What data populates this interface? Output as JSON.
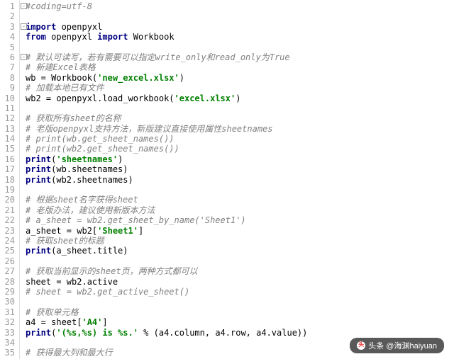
{
  "watermark": "头条 @海渊haiyuan",
  "lines": [
    {
      "n": 1,
      "fold": true,
      "tokens": [
        {
          "c": "cm",
          "t": "#coding=utf-8"
        }
      ]
    },
    {
      "n": 2,
      "tokens": []
    },
    {
      "n": 3,
      "fold": true,
      "tokens": [
        {
          "c": "kw",
          "t": "import"
        },
        {
          "c": "id",
          "t": " openpyxl"
        }
      ]
    },
    {
      "n": 4,
      "tokens": [
        {
          "c": "kw",
          "t": "from"
        },
        {
          "c": "id",
          "t": " openpyxl "
        },
        {
          "c": "kw",
          "t": "import"
        },
        {
          "c": "id",
          "t": " Workbook"
        }
      ]
    },
    {
      "n": 5,
      "tokens": []
    },
    {
      "n": 6,
      "fold": true,
      "tokens": [
        {
          "c": "cm",
          "t": "# 默认可读写，若有需要可以指定write_only和read_only为True"
        }
      ]
    },
    {
      "n": 7,
      "tokens": [
        {
          "c": "cm",
          "t": "# 新建Excel表格"
        }
      ]
    },
    {
      "n": 8,
      "tokens": [
        {
          "c": "id",
          "t": "wb = Workbook("
        },
        {
          "c": "str",
          "t": "'new_excel.xlsx'"
        },
        {
          "c": "id",
          "t": ")"
        }
      ]
    },
    {
      "n": 9,
      "tokens": [
        {
          "c": "cm",
          "t": "# 加载本地已有文件"
        }
      ]
    },
    {
      "n": 10,
      "tokens": [
        {
          "c": "id",
          "t": "wb2 = openpyxl.load_workbook("
        },
        {
          "c": "str",
          "t": "'excel.xlsx'"
        },
        {
          "c": "id",
          "t": ")"
        }
      ]
    },
    {
      "n": 11,
      "tokens": []
    },
    {
      "n": 12,
      "tokens": [
        {
          "c": "cm",
          "t": "# 获取所有sheet的名称"
        }
      ]
    },
    {
      "n": 13,
      "tokens": [
        {
          "c": "cm",
          "t": "# 老版openpyxl支持方法，新版建议直接使用属性sheetnames"
        }
      ]
    },
    {
      "n": 14,
      "tokens": [
        {
          "c": "cm",
          "t": "# print(wb.get_sheet_names())"
        }
      ]
    },
    {
      "n": 15,
      "tokens": [
        {
          "c": "cm",
          "t": "# print(wb2.get_sheet_names())"
        }
      ]
    },
    {
      "n": 16,
      "tokens": [
        {
          "c": "kw",
          "t": "print"
        },
        {
          "c": "id",
          "t": "("
        },
        {
          "c": "str",
          "t": "'sheetnames'"
        },
        {
          "c": "id",
          "t": ")"
        }
      ]
    },
    {
      "n": 17,
      "tokens": [
        {
          "c": "kw",
          "t": "print"
        },
        {
          "c": "id",
          "t": "(wb.sheetnames)"
        }
      ]
    },
    {
      "n": 18,
      "tokens": [
        {
          "c": "kw",
          "t": "print"
        },
        {
          "c": "id",
          "t": "(wb2.sheetnames)"
        }
      ]
    },
    {
      "n": 19,
      "tokens": []
    },
    {
      "n": 20,
      "tokens": [
        {
          "c": "cm",
          "t": "# 根据sheet名字获得sheet"
        }
      ]
    },
    {
      "n": 21,
      "tokens": [
        {
          "c": "cm",
          "t": "# 老版办法，建议使用新版本方法"
        }
      ]
    },
    {
      "n": 22,
      "tokens": [
        {
          "c": "cm",
          "t": "# a_sheet = wb2.get_sheet_by_name('Sheet1')"
        }
      ]
    },
    {
      "n": 23,
      "tokens": [
        {
          "c": "id",
          "t": "a_sheet = wb2["
        },
        {
          "c": "str",
          "t": "'Sheet1'"
        },
        {
          "c": "id",
          "t": "]"
        }
      ]
    },
    {
      "n": 24,
      "tokens": [
        {
          "c": "cm",
          "t": "# 获取sheet的标题"
        }
      ]
    },
    {
      "n": 25,
      "tokens": [
        {
          "c": "kw",
          "t": "print"
        },
        {
          "c": "id",
          "t": "(a_sheet.title)"
        }
      ]
    },
    {
      "n": 26,
      "tokens": []
    },
    {
      "n": 27,
      "tokens": [
        {
          "c": "cm",
          "t": "# 获取当前显示的sheet页，两种方式都可以"
        }
      ]
    },
    {
      "n": 28,
      "tokens": [
        {
          "c": "id",
          "t": "sheet = wb2.active"
        }
      ]
    },
    {
      "n": 29,
      "tokens": [
        {
          "c": "cm",
          "t": "# sheet = wb2.get_active_sheet()"
        }
      ]
    },
    {
      "n": 30,
      "tokens": []
    },
    {
      "n": 31,
      "tokens": [
        {
          "c": "cm",
          "t": "# 获取单元格"
        }
      ]
    },
    {
      "n": 32,
      "tokens": [
        {
          "c": "id",
          "t": "a4 = sheet["
        },
        {
          "c": "str",
          "t": "'A4'"
        },
        {
          "c": "id",
          "t": "]"
        }
      ]
    },
    {
      "n": 33,
      "tokens": [
        {
          "c": "kw",
          "t": "print"
        },
        {
          "c": "id",
          "t": "("
        },
        {
          "c": "str",
          "t": "'(%s,%s) is %s.'"
        },
        {
          "c": "id",
          "t": " % (a4.column, a4.row, a4.value))"
        }
      ]
    },
    {
      "n": 34,
      "tokens": []
    },
    {
      "n": 35,
      "tokens": [
        {
          "c": "cm",
          "t": "# 获得最大列和最大行"
        }
      ]
    }
  ]
}
